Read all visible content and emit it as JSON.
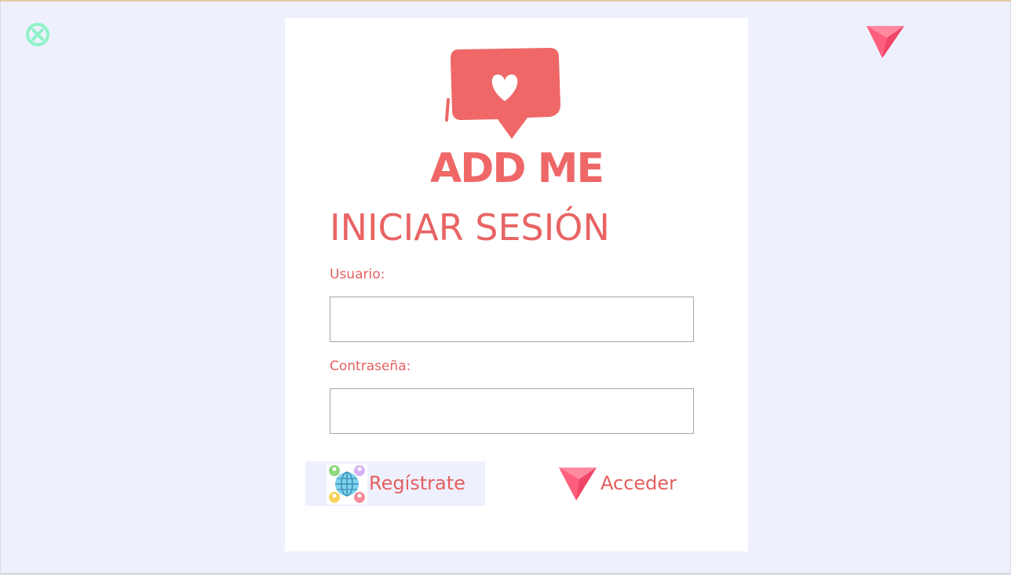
{
  "window": {
    "close_icon": "close-circle-x-icon",
    "corner_icon": "send-arrow-icon"
  },
  "logo": {
    "icon": "heart-speech-bubble-icon",
    "text": "ADD ME"
  },
  "form": {
    "title": "INICIAR SESIÓN",
    "username_label": "Usuario:",
    "username_value": "",
    "password_label": "Contraseña:",
    "password_value": ""
  },
  "actions": {
    "register_label": "Regístrate",
    "register_icon": "globe-people-icon",
    "login_label": "Acceder",
    "login_icon": "send-arrow-icon"
  },
  "colors": {
    "background": "#eef0fe",
    "card": "#ffffff",
    "accent": "#ef6767",
    "close_icon": "#8ff3c8",
    "arrow": "#ff5a7a"
  }
}
